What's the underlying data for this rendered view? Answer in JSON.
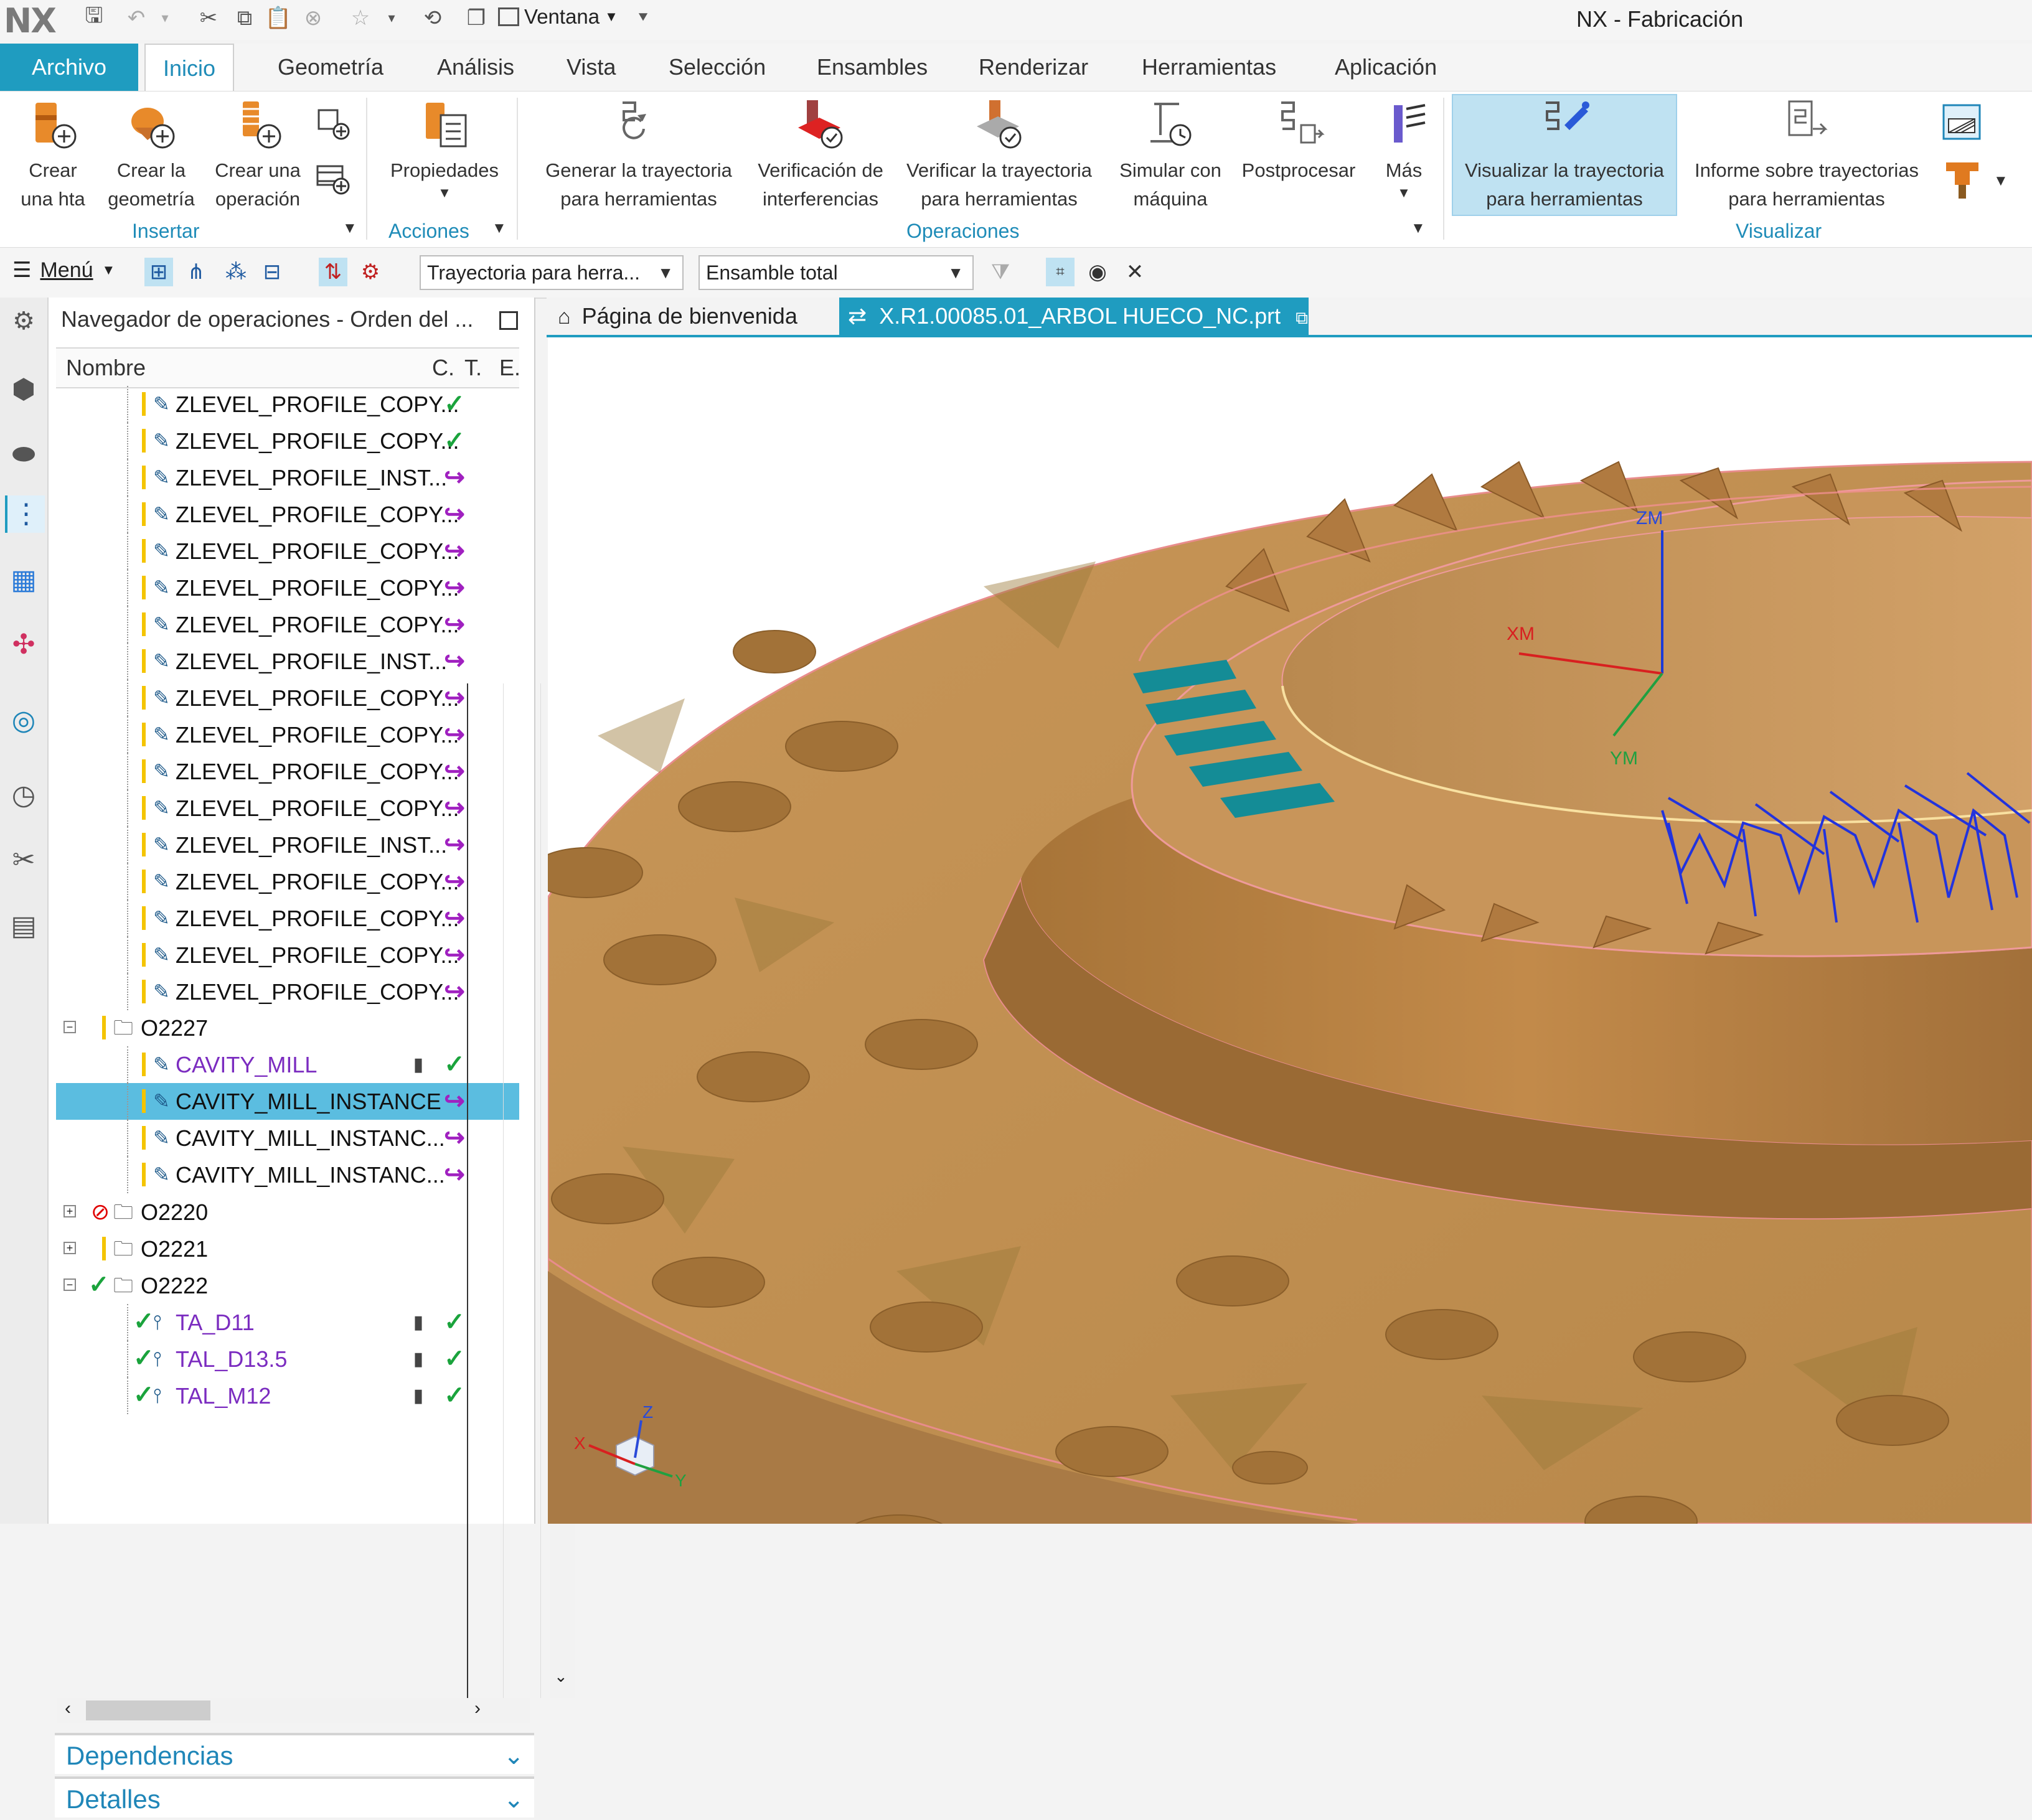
{
  "app": {
    "logo": "NX",
    "title": "NX - Fabricación",
    "window_menu": "Ventana"
  },
  "ribbon_tabs": [
    "Archivo",
    "Inicio",
    "Geometría",
    "Análisis",
    "Vista",
    "Selección",
    "Ensambles",
    "Renderizar",
    "Herramientas",
    "Aplicación"
  ],
  "ribbon": {
    "insertar": {
      "label": "Insertar",
      "crear_hta": [
        "Crear",
        "una hta"
      ],
      "crear_geometria": [
        "Crear la",
        "geometría"
      ],
      "crear_operacion": [
        "Crear una",
        "operación"
      ]
    },
    "acciones": {
      "label": "Acciones",
      "propiedades": "Propiedades"
    },
    "operaciones": {
      "label": "Operaciones",
      "generar": [
        "Generar la trayectoria",
        "para herramientas"
      ],
      "verificacion": [
        "Verificación de",
        "interferencias"
      ],
      "verificar": [
        "Verificar la trayectoria",
        "para herramientas"
      ],
      "simular": [
        "Simular con",
        "máquina"
      ],
      "postprocesar": "Postprocesar",
      "mas": "Más"
    },
    "visualizar": {
      "label": "Visualizar",
      "visualizar_tray": [
        "Visualizar la trayectoria",
        "para herramientas"
      ],
      "informe": [
        "Informe sobre trayectorias",
        "para herramientas"
      ]
    }
  },
  "toolbar": {
    "menu": "Menú",
    "filter_combo": "Trayectoria para herra...",
    "assembly_combo": "Ensamble total"
  },
  "navigator": {
    "title": "Navegador de operaciones - Orden del ...",
    "columns": {
      "name": "Nombre",
      "c": "C.",
      "t": "T.",
      "e": "E."
    },
    "rows": [
      {
        "name": "ZLEVEL_PROFILE_COPY...",
        "status": "ok"
      },
      {
        "name": "ZLEVEL_PROFILE_COPY...",
        "status": "ok"
      },
      {
        "name": "ZLEVEL_PROFILE_INST...",
        "status": "repl"
      },
      {
        "name": "ZLEVEL_PROFILE_COPY...",
        "status": "repl"
      },
      {
        "name": "ZLEVEL_PROFILE_COPY...",
        "status": "repl"
      },
      {
        "name": "ZLEVEL_PROFILE_COPY...",
        "status": "repl"
      },
      {
        "name": "ZLEVEL_PROFILE_COPY...",
        "status": "repl"
      },
      {
        "name": "ZLEVEL_PROFILE_INST...",
        "status": "repl"
      },
      {
        "name": "ZLEVEL_PROFILE_COPY...",
        "status": "repl"
      },
      {
        "name": "ZLEVEL_PROFILE_COPY...",
        "status": "repl"
      },
      {
        "name": "ZLEVEL_PROFILE_COPY...",
        "status": "repl"
      },
      {
        "name": "ZLEVEL_PROFILE_COPY...",
        "status": "repl"
      },
      {
        "name": "ZLEVEL_PROFILE_INST...",
        "status": "repl"
      },
      {
        "name": "ZLEVEL_PROFILE_COPY...",
        "status": "repl"
      },
      {
        "name": "ZLEVEL_PROFILE_COPY...",
        "status": "repl"
      },
      {
        "name": "ZLEVEL_PROFILE_COPY...",
        "status": "repl"
      },
      {
        "name": "ZLEVEL_PROFILE_COPY...",
        "status": "repl"
      }
    ],
    "group_o2227": "O2227",
    "cavity_rows": [
      {
        "name": "CAVITY_MILL",
        "status": "ok"
      },
      {
        "name": "CAVITY_MILL_INSTANCE",
        "status": "repl"
      },
      {
        "name": "CAVITY_MILL_INSTANC...",
        "status": "repl"
      },
      {
        "name": "CAVITY_MILL_INSTANC...",
        "status": "repl"
      }
    ],
    "group_o2220": "O2220",
    "group_o2221": "O2221",
    "group_o2222": "O2222",
    "tool_rows": [
      {
        "name": "TA_D11",
        "status": "ok"
      },
      {
        "name": "TAL_D13.5",
        "status": "ok"
      },
      {
        "name": "TAL_M12",
        "status": "ok"
      }
    ],
    "panels": {
      "dependencias": "Dependencias",
      "detalles": "Detalles"
    }
  },
  "doc_tabs": {
    "welcome": "Página de bienvenida",
    "part": "X.R1.00085.01_ARBOL HUECO_NC.prt"
  },
  "viewport": {
    "axis_zm": "ZM",
    "axis_xm": "XM",
    "axis_ym": "YM",
    "triad_z": "Z",
    "triad_x": "X",
    "triad_y": "Y"
  },
  "colors": {
    "accent": "#1f9cc0",
    "part_body": "#c9955a",
    "toolpath": "#2233dd",
    "status_ok": "#1aa33c",
    "status_replay": "#a020c0"
  }
}
